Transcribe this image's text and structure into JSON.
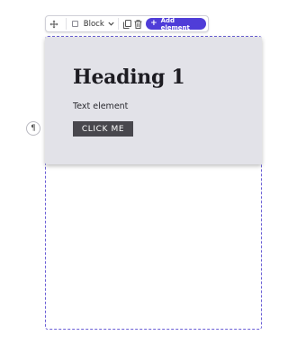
{
  "toolbar": {
    "block_label": "Block",
    "add_element_label": "Add element",
    "accent_color": "#4f3dd8",
    "icons": [
      "move-icon",
      "block-square-icon",
      "chevron-down-icon",
      "copy-icon",
      "trash-icon",
      "plus-icon"
    ]
  },
  "hero": {
    "heading": "Heading 1",
    "text": "Text element",
    "button_label": "CLICK ME",
    "background_color": "#e2e2e8",
    "button_color": "#48474d"
  },
  "paragraph_handle": {
    "glyph": "¶"
  },
  "container": {
    "outline_color": "#6a5fd6",
    "outline_style": "dashed"
  }
}
